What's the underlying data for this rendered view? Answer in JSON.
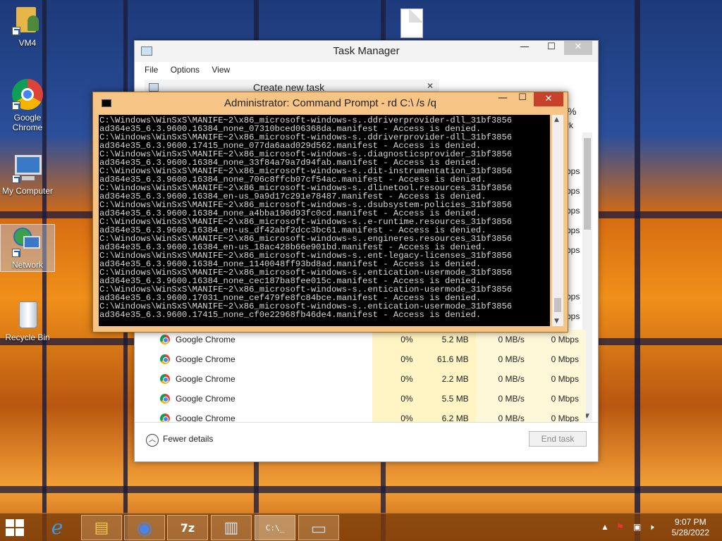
{
  "desktop": {
    "icons": [
      {
        "label": "VM4"
      },
      {
        "label": "Google Chrome"
      },
      {
        "label": "My Computer"
      },
      {
        "label": "Network"
      },
      {
        "label": "Recycle Bin"
      }
    ]
  },
  "task_manager": {
    "title": "Task Manager",
    "menu": [
      "File",
      "Options",
      "View"
    ],
    "new_task_label": "Create new task",
    "header_partial": "%",
    "header_partial2": "rk",
    "partial_rows": [
      "bps",
      "bps",
      "bps",
      "bps",
      "bps",
      "bps",
      "bps"
    ],
    "rows": [
      {
        "name": "Google Chrome",
        "cpu": "0%",
        "memory": "5.2 MB",
        "disk": "0 MB/s",
        "network": "0 Mbps"
      },
      {
        "name": "Google Chrome",
        "cpu": "0%",
        "memory": "61.6 MB",
        "disk": "0 MB/s",
        "network": "0 Mbps"
      },
      {
        "name": "Google Chrome",
        "cpu": "0%",
        "memory": "2.2 MB",
        "disk": "0 MB/s",
        "network": "0 Mbps"
      },
      {
        "name": "Google Chrome",
        "cpu": "0%",
        "memory": "5.5 MB",
        "disk": "0 MB/s",
        "network": "0 Mbps"
      },
      {
        "name": "Google Chrome",
        "cpu": "0%",
        "memory": "6.2 MB",
        "disk": "0 MB/s",
        "network": "0 Mbps"
      }
    ],
    "fewer_details": "Fewer details",
    "end_task": "End task"
  },
  "cmd": {
    "title": "Administrator: Command Prompt - rd  C:\\ /s /q",
    "lines": [
      "C:\\Windows\\WinSxS\\MANIFE~2\\x86_microsoft-windows-s..ddriverprovider-dll_31bf3856",
      "ad364e35_6.3.9600.16384_none_07310bced06368da.manifest - Access is denied.",
      "C:\\Windows\\WinSxS\\MANIFE~2\\x86_microsoft-windows-s..ddriverprovider-dll_31bf3856",
      "ad364e35_6.3.9600.17415_none_077da6aad029d562.manifest - Access is denied.",
      "C:\\Windows\\WinSxS\\MANIFE~2\\x86_microsoft-windows-s..diagnosticsprovider_31bf3856",
      "ad364e35_6.3.9600.16384_none_33f84a79a7d94fab.manifest - Access is denied.",
      "C:\\Windows\\WinSxS\\MANIFE~2\\x86_microsoft-windows-s..dit-instrumentation_31bf3856",
      "ad364e35_6.3.9600.16384_none_706c8ffcb07cf54ac.manifest - Access is denied.",
      "C:\\Windows\\WinSxS\\MANIFE~2\\x86_microsoft-windows-s..dlinetool.resources_31bf3856",
      "ad364e35_6.3.9600.16384_en-us_9a9d17c291e78487.manifest - Access is denied.",
      "C:\\Windows\\WinSxS\\MANIFE~2\\x86_microsoft-windows-s..dsubsystem-policies_31bf3856",
      "ad364e35_6.3.9600.16384_none_a4bba190d93fc0cd.manifest - Access is denied.",
      "C:\\Windows\\WinSxS\\MANIFE~2\\x86_microsoft-windows-s..e-runtime.resources_31bf3856",
      "ad364e35_6.3.9600.16384_en-us_df42abf2dcc3bc61.manifest - Access is denied.",
      "C:\\Windows\\WinSxS\\MANIFE~2\\x86_microsoft-windows-s..engineres.resources_31bf3856",
      "ad364e35_6.3.9600.16384_en-us_18ac428b66e901bd.manifest - Access is denied.",
      "C:\\Windows\\WinSxS\\MANIFE~2\\x86_microsoft-windows-s..ent-legacy-licenses_31bf3856",
      "ad364e35_6.3.9600.16384_none_1140048ff93bd8ad.manifest - Access is denied.",
      "C:\\Windows\\WinSxS\\MANIFE~2\\x86_microsoft-windows-s..entication-usermode_31bf3856",
      "ad364e35_6.3.9600.16384_none_cec187ba8fee015c.manifest - Access is denied.",
      "C:\\Windows\\WinSxS\\MANIFE~2\\x86_microsoft-windows-s..entication-usermode_31bf3856",
      "ad364e35_6.3.9600.17031_none_cef479fe8fc84bce.manifest - Access is denied.",
      "C:\\Windows\\WinSxS\\MANIFE~2\\x86_microsoft-windows-s..entication-usermode_31bf3856",
      "ad364e35_6.3.9600.17415_none_cf0e22968fb46de4.manifest - Access is denied."
    ]
  },
  "taskbar": {
    "items": [
      {
        "icon": "internet-explorer-icon",
        "glyph": "e"
      },
      {
        "icon": "file-explorer-icon",
        "glyph": "▤"
      },
      {
        "icon": "chrome-icon",
        "glyph": "◉"
      },
      {
        "icon": "7zip-icon",
        "glyph": "7z"
      },
      {
        "icon": "task-manager-icon",
        "glyph": "▥"
      },
      {
        "icon": "command-prompt-icon",
        "glyph": "C:\\_"
      },
      {
        "icon": "window-icon",
        "glyph": "▭"
      }
    ],
    "time": "9:07 PM",
    "date": "5/28/2022"
  }
}
